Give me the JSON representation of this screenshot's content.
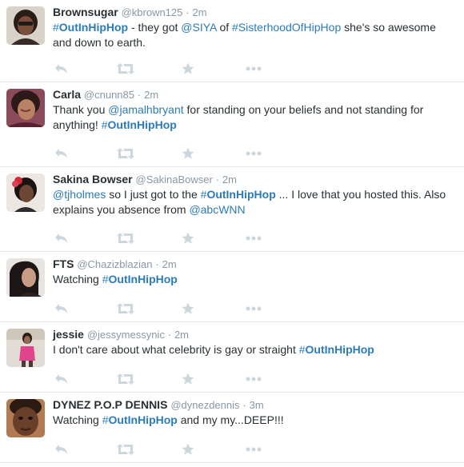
{
  "tweets": [
    {
      "fullname": "Brownsugar",
      "username": "@kbrown125",
      "time": "2m",
      "parts": [
        {
          "type": "hashtag",
          "text": "OutInHipHop"
        },
        {
          "type": "text",
          "text": " - they got "
        },
        {
          "type": "mention",
          "text": "@SIYA"
        },
        {
          "type": "text",
          "text": " of "
        },
        {
          "type": "link",
          "text": "#SisterhoodOfHipHop"
        },
        {
          "type": "text",
          "text": " she's so awesome and down to earth."
        }
      ]
    },
    {
      "fullname": "Carla",
      "username": "@cnunn85",
      "time": "2m",
      "parts": [
        {
          "type": "text",
          "text": "Thank you "
        },
        {
          "type": "mention",
          "text": "@jamalhbryant"
        },
        {
          "type": "text",
          "text": " for standing on your beliefs and not standing for anything! "
        },
        {
          "type": "hashtag",
          "text": "OutInHipHop"
        }
      ]
    },
    {
      "fullname": "Sakina Bowser",
      "username": "@SakinaBowser",
      "time": "2m",
      "parts": [
        {
          "type": "mention",
          "text": "@tjholmes"
        },
        {
          "type": "text",
          "text": " so I just got to the "
        },
        {
          "type": "hashtag",
          "text": "OutInHipHop"
        },
        {
          "type": "text",
          "text": " ... I love that you hosted this. Also explains you absence from "
        },
        {
          "type": "mention",
          "text": "@abcWNN"
        }
      ]
    },
    {
      "fullname": "FTS",
      "username": "@Chazizblazian",
      "time": "2m",
      "parts": [
        {
          "type": "text",
          "text": "Watching "
        },
        {
          "type": "hashtag",
          "text": "OutInHipHop"
        }
      ]
    },
    {
      "fullname": "jessie",
      "username": "@jessymessynic",
      "time": "2m",
      "parts": [
        {
          "type": "text",
          "text": "I don't care about what celebrity is gay or straight "
        },
        {
          "type": "hashtag",
          "text": "OutInHipHop"
        }
      ]
    },
    {
      "fullname": "DYNEZ P.O.P DENNIS",
      "username": "@dynezdennis",
      "time": "3m",
      "parts": [
        {
          "type": "text",
          "text": "Watching "
        },
        {
          "type": "hashtag",
          "text": "OutInHipHop"
        },
        {
          "type": "text",
          "text": " and my my...DEEP!!!"
        }
      ]
    }
  ],
  "separator": "·",
  "icons": {
    "reply": "reply-icon",
    "retweet": "retweet-icon",
    "favorite": "star-icon",
    "more": "more-icon"
  },
  "colors": {
    "link": "#2b7bb9",
    "text": "#292f33",
    "muted": "#8899a6",
    "icon": "#ccd6dd",
    "divider": "#e1e8ed"
  }
}
